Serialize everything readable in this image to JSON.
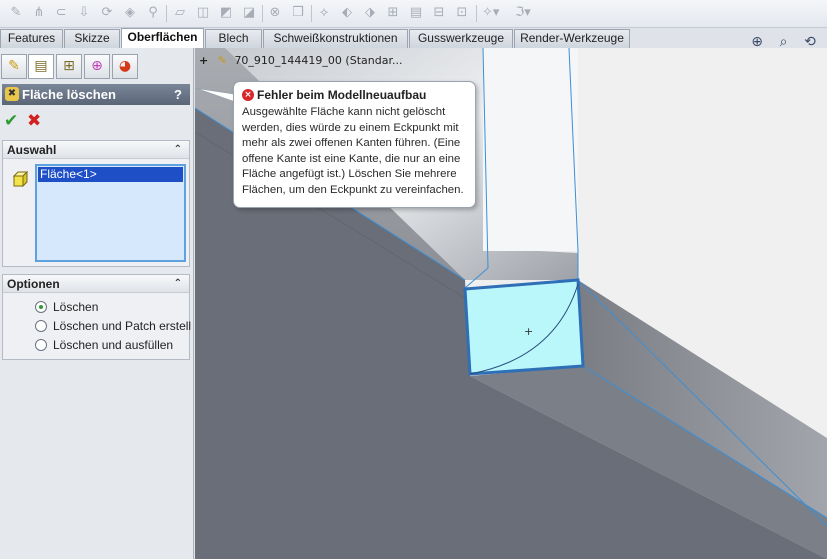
{
  "toolbar": {
    "icons": [
      "sketch-fillet-icon",
      "loft-icon",
      "sweep-icon",
      "extrude-icon",
      "revolve-icon",
      "boundary-icon",
      "knit-icon",
      "offset-surface-icon",
      "ruled-surface-icon",
      "planar-surface-icon",
      "trim-surface-icon",
      "untrim-icon",
      "delete-face-icon",
      "replace-face-icon",
      "move-face-icon",
      "extend-icon",
      "thicken-icon",
      "fill-icon",
      "mid-surface-icon",
      "radiate-icon",
      "curves-dropdown-icon",
      "reference-geometry-dropdown-icon"
    ]
  },
  "tabs": [
    {
      "label": "Features",
      "active": false
    },
    {
      "label": "Skizze",
      "active": false
    },
    {
      "label": "Oberflächen",
      "active": true
    },
    {
      "label": "Blech",
      "active": false
    },
    {
      "label": "Schweißkonstruktionen",
      "active": false
    },
    {
      "label": "Gusswerkzeuge",
      "active": false
    },
    {
      "label": "Render-Werkzeuge",
      "active": false
    }
  ],
  "panel": {
    "manager_tabs": [
      "featuremanager-icon",
      "propertymanager-icon",
      "configurationmanager-icon",
      "dimxpert-icon",
      "display-manager-icon"
    ],
    "title": "Fläche löschen",
    "help": "?",
    "ok_glyph": "✔",
    "cancel_glyph": "✖",
    "selection": {
      "title": "Auswahl",
      "items": [
        "Fläche<1>"
      ]
    },
    "options": {
      "title": "Optionen",
      "radios": [
        {
          "label": "Löschen",
          "checked": true
        },
        {
          "label": "Löschen und Patch erstell",
          "checked": false
        },
        {
          "label": "Löschen und ausfüllen",
          "checked": false
        }
      ]
    }
  },
  "viewport": {
    "tree_expand": "+",
    "tree_node": "70_910_144419_00  (Standar...",
    "view_tools": [
      "zoom-to-fit-icon",
      "zoom-to-area-icon",
      "previous-view-icon"
    ]
  },
  "error": {
    "title": "Fehler beim Modellneuaufbau",
    "icon": "×",
    "lines": [
      "Ausgewählte Fläche kann nicht gelöscht",
      "werden, dies würde zu einem Eckpunkt mit",
      "mehr als zwei offenen Kanten führen. (Eine",
      "offene Kante ist eine Kante, die nur an eine",
      "Fläche angefügt ist.)  Löschen Sie mehrere",
      "Flächen, um den Eckpunkt zu vereinfachen."
    ]
  },
  "colors": {
    "selected_face": "#b9f7fb",
    "selection_highlight": "#1e4fc6",
    "error_red": "#d9262b"
  }
}
